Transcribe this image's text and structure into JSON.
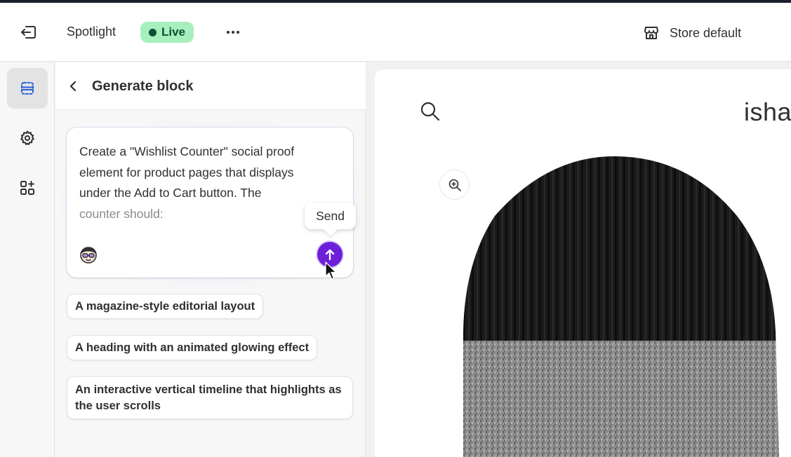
{
  "topbar": {
    "app_title": "Spotlight",
    "live_label": "Live",
    "store_label": "Store default",
    "colors": {
      "live_bg": "#a7efbd",
      "live_text": "#0c5132"
    }
  },
  "rail": {
    "items": [
      {
        "name": "sections-icon",
        "active": true
      },
      {
        "name": "gear-icon",
        "active": false
      },
      {
        "name": "apps-icon",
        "active": false
      }
    ]
  },
  "panel": {
    "title": "Generate block",
    "prompt": {
      "lines": [
        "Create a \"Wishlist Counter\" social proof",
        "element for product pages that displays",
        "under the Add to Cart button. The"
      ],
      "faded_line": "counter should:"
    },
    "send_tooltip": "Send",
    "suggestions": [
      "A magazine-style editorial layout",
      "A heading with an animated glowing effect",
      "An interactive vertical timeline that highlights as the user scrolls"
    ],
    "colors": {
      "send_button": "#6d1fd8"
    }
  },
  "preview": {
    "store_name": "isha",
    "icons": [
      "search-icon",
      "zoom-in-icon"
    ],
    "product_image": "beanie-hat"
  }
}
